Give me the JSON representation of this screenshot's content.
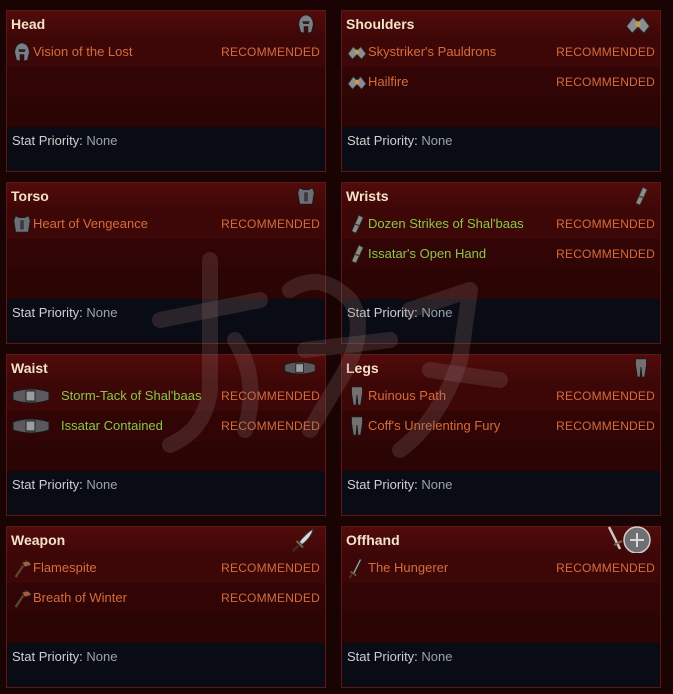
{
  "recommended_label": "RECOMMENDED",
  "stat_priority_label": "Stat Priority:",
  "panels": [
    {
      "title": "Head",
      "slot_icon": "helmet-icon",
      "stat_value": "None",
      "items": [
        {
          "name": "Vision of the Lost",
          "color": "orange",
          "icon": "helmet-icon"
        }
      ]
    },
    {
      "title": "Shoulders",
      "slot_icon": "pauldrons-icon",
      "stat_value": "None",
      "items": [
        {
          "name": "Skystriker's Pauldrons",
          "color": "orange",
          "icon": "pauldrons-icon"
        },
        {
          "name": "Hailfire",
          "color": "orange",
          "icon": "pauldrons-icon"
        }
      ]
    },
    {
      "title": "Torso",
      "slot_icon": "chest-armor-icon",
      "stat_value": "None",
      "items": [
        {
          "name": "Heart of Vengeance",
          "color": "orange",
          "icon": "chest-armor-icon"
        }
      ]
    },
    {
      "title": "Wrists",
      "slot_icon": "bracer-icon",
      "stat_value": "None",
      "items": [
        {
          "name": "Dozen Strikes of Shal'baas",
          "color": "green",
          "icon": "bracer-icon"
        },
        {
          "name": "Issatar's Open Hand",
          "color": "green",
          "icon": "bracer-icon"
        }
      ]
    },
    {
      "title": "Waist",
      "slot_icon": "belt-icon",
      "stat_value": "None",
      "items": [
        {
          "name": "Storm-Tack of Shal'baas",
          "color": "green",
          "icon": "belt-icon"
        },
        {
          "name": "Issatar Contained",
          "color": "green",
          "icon": "belt-icon"
        }
      ]
    },
    {
      "title": "Legs",
      "slot_icon": "leggings-icon",
      "stat_value": "None",
      "items": [
        {
          "name": "Ruinous Path",
          "color": "orange",
          "icon": "leggings-icon"
        },
        {
          "name": "Coff's Unrelenting Fury",
          "color": "orange",
          "icon": "leggings-icon"
        }
      ]
    },
    {
      "title": "Weapon",
      "slot_icon": "dagger-icon",
      "stat_value": "None",
      "items": [
        {
          "name": "Flamespite",
          "color": "orange",
          "icon": "axe-icon"
        },
        {
          "name": "Breath of Winter",
          "color": "orange",
          "icon": "axe-icon"
        }
      ]
    },
    {
      "title": "Offhand",
      "slot_icon": "sword-and-shield-icon",
      "stat_value": "None",
      "items": [
        {
          "name": "The Hungerer",
          "color": "orange",
          "icon": "sword-icon"
        }
      ]
    }
  ]
}
